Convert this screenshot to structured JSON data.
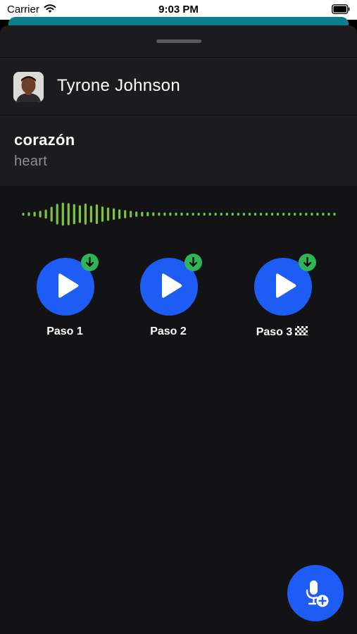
{
  "status_bar": {
    "carrier": "Carrier",
    "time": "9:03 PM",
    "icons": [
      "wifi-icon",
      "battery-icon"
    ]
  },
  "contact": {
    "name": "Tyrone Johnson"
  },
  "word": {
    "term": "corazón",
    "translation": "heart"
  },
  "waveform": {
    "color": "#7dc242",
    "levels": [
      0.12,
      0.16,
      0.2,
      0.28,
      0.38,
      0.62,
      0.86,
      0.96,
      0.92,
      0.84,
      0.74,
      0.88,
      0.7,
      0.82,
      0.64,
      0.56,
      0.48,
      0.4,
      0.34,
      0.28,
      0.22,
      0.2,
      0.18,
      0.16,
      0.14,
      0.14,
      0.14,
      0.13,
      0.13,
      0.12,
      0.12,
      0.12,
      0.12,
      0.12,
      0.12,
      0.12,
      0.12,
      0.12,
      0.12,
      0.12,
      0.12,
      0.12,
      0.12,
      0.12,
      0.12,
      0.12,
      0.12,
      0.12,
      0.12,
      0.12,
      0.12,
      0.12,
      0.12,
      0.12,
      0.12,
      0.12
    ]
  },
  "steps": [
    {
      "label": "Paso 1",
      "icon": "play-icon",
      "badge": "download-icon"
    },
    {
      "label": "Paso 2",
      "icon": "play-icon",
      "badge": "download-icon"
    },
    {
      "label": "Paso 3",
      "icon": "play-icon",
      "badge": "download-icon",
      "suffix_icon": "checkered-flag-icon"
    }
  ],
  "fab": {
    "icon": "add-recording-icon"
  },
  "colors": {
    "accent": "#1d5cf5",
    "badge": "#2fb457",
    "header_strip": "#0d7d8c",
    "sheet": "#131315",
    "card": "#1c1c1e"
  }
}
